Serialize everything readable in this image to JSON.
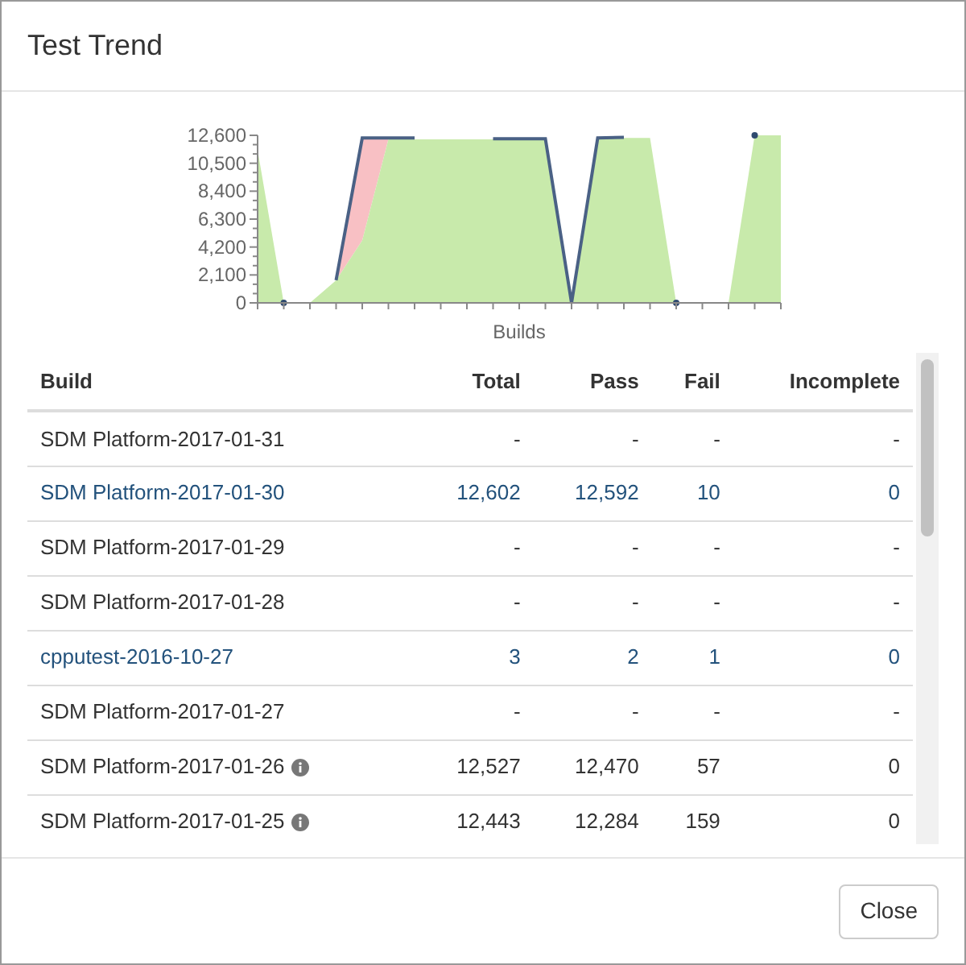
{
  "dialog": {
    "title": "Test Trend",
    "close_button": "Close"
  },
  "chart": {
    "x_axis_label": "Builds",
    "y_tick_labels": [
      "12,600",
      "10,500",
      "8,400",
      "6,300",
      "4,200",
      "2,100",
      "0"
    ]
  },
  "table": {
    "columns": [
      "Build",
      "Total",
      "Pass",
      "Fail",
      "Incomplete"
    ],
    "rows": [
      {
        "link": false,
        "info": false,
        "cells": [
          "SDM Platform-2017-01-31",
          "-",
          "-",
          "-",
          "-"
        ]
      },
      {
        "link": true,
        "info": false,
        "cells": [
          "SDM Platform-2017-01-30",
          "12,602",
          "12,592",
          "10",
          "0"
        ]
      },
      {
        "link": false,
        "info": false,
        "cells": [
          "SDM Platform-2017-01-29",
          "-",
          "-",
          "-",
          "-"
        ]
      },
      {
        "link": false,
        "info": false,
        "cells": [
          "SDM Platform-2017-01-28",
          "-",
          "-",
          "-",
          "-"
        ]
      },
      {
        "link": true,
        "info": false,
        "cells": [
          "cpputest-2016-10-27",
          "3",
          "2",
          "1",
          "0"
        ]
      },
      {
        "link": false,
        "info": false,
        "cells": [
          "SDM Platform-2017-01-27",
          "-",
          "-",
          "-",
          "-"
        ]
      },
      {
        "link": false,
        "info": true,
        "cells": [
          "SDM Platform-2017-01-26",
          "12,527",
          "12,470",
          "57",
          "0"
        ]
      },
      {
        "link": false,
        "info": true,
        "cells": [
          "SDM Platform-2017-01-25",
          "12,443",
          "12,284",
          "159",
          "0"
        ]
      }
    ]
  }
}
